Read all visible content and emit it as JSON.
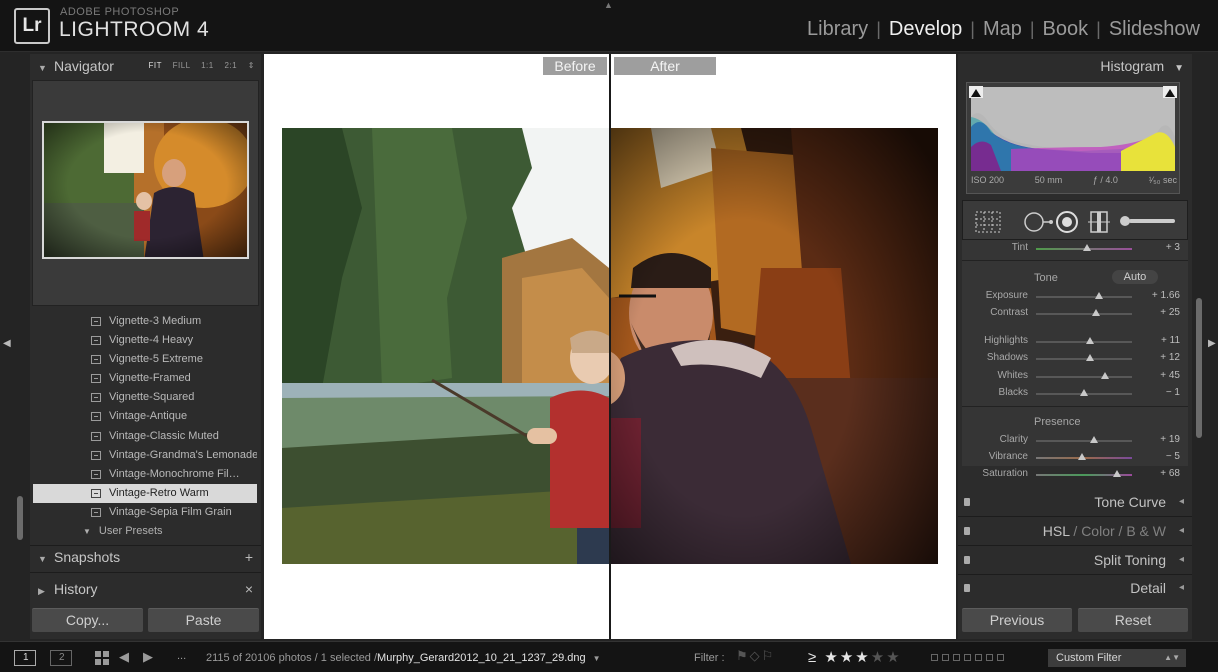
{
  "header": {
    "logo": "Lr",
    "brand_top": "ADOBE PHOTOSHOP",
    "brand_main": "LIGHTROOM 4",
    "modules": [
      "Library",
      "Develop",
      "Map",
      "Book",
      "Slideshow"
    ],
    "active_module": "Develop"
  },
  "navigator": {
    "title": "Navigator",
    "options": [
      "FIT",
      "FILL",
      "1:1",
      "2:1"
    ],
    "selected_option": "FIT"
  },
  "presets": {
    "items": [
      "Vignette-3 Medium",
      "Vignette-4 Heavy",
      "Vignette-5 Extreme",
      "Vignette-Framed",
      "Vignette-Squared",
      "Vintage-Antique",
      "Vintage-Classic Muted",
      "Vintage-Grandma's Lemonade",
      "Vintage-Monochrome Fil…",
      "Vintage-Retro Warm",
      "Vintage-Sepia Film Grain"
    ],
    "selected": "Vintage-Retro Warm",
    "user_folder": "User Presets"
  },
  "snapshots": {
    "title": "Snapshots",
    "action": "+"
  },
  "history": {
    "title": "History",
    "action": "×"
  },
  "left_buttons": {
    "copy": "Copy...",
    "paste": "Paste"
  },
  "compare": {
    "before": "Before",
    "after": "After"
  },
  "histogram": {
    "title": "Histogram",
    "iso": "ISO 200",
    "focal": "50 mm",
    "aperture": "ƒ / 4.0",
    "shutter": "¹⁄₅₀ sec"
  },
  "basic": {
    "tint": {
      "label": "Tint",
      "value": "+ 3",
      "pos": 0.53
    },
    "tone_label": "Tone",
    "auto_label": "Auto",
    "exposure": {
      "label": "Exposure",
      "value": "+ 1.66",
      "pos": 0.66
    },
    "contrast": {
      "label": "Contrast",
      "value": "+ 25",
      "pos": 0.62
    },
    "highlights": {
      "label": "Highlights",
      "value": "+ 11",
      "pos": 0.56
    },
    "shadows": {
      "label": "Shadows",
      "value": "+ 12",
      "pos": 0.56
    },
    "whites": {
      "label": "Whites",
      "value": "+ 45",
      "pos": 0.72
    },
    "blacks": {
      "label": "Blacks",
      "value": "− 1",
      "pos": 0.5
    },
    "presence_label": "Presence",
    "clarity": {
      "label": "Clarity",
      "value": "+ 19",
      "pos": 0.6
    },
    "vibrance": {
      "label": "Vibrance",
      "value": "− 5",
      "pos": 0.48
    },
    "saturation": {
      "label": "Saturation",
      "value": "+ 68",
      "pos": 0.84
    }
  },
  "panels": {
    "tone_curve": "Tone Curve",
    "hsl_a": "HSL",
    "hsl_b": "Color",
    "hsl_c": "B & W",
    "hsl_sep": "/",
    "split_toning": "Split Toning",
    "detail": "Detail"
  },
  "right_buttons": {
    "previous": "Previous",
    "reset": "Reset"
  },
  "filmstrip": {
    "monitor1": "1",
    "monitor2": "2",
    "dots": "...",
    "info": "2115 of 20106 photos / 1 selected /",
    "filename": "Murphy_Gerard2012_10_21_1237_29.dng",
    "filter_label": "Filter :",
    "rating_op": "≥",
    "stars_on": "★★★",
    "stars_off": "★★",
    "custom_filter": "Custom Filter"
  }
}
